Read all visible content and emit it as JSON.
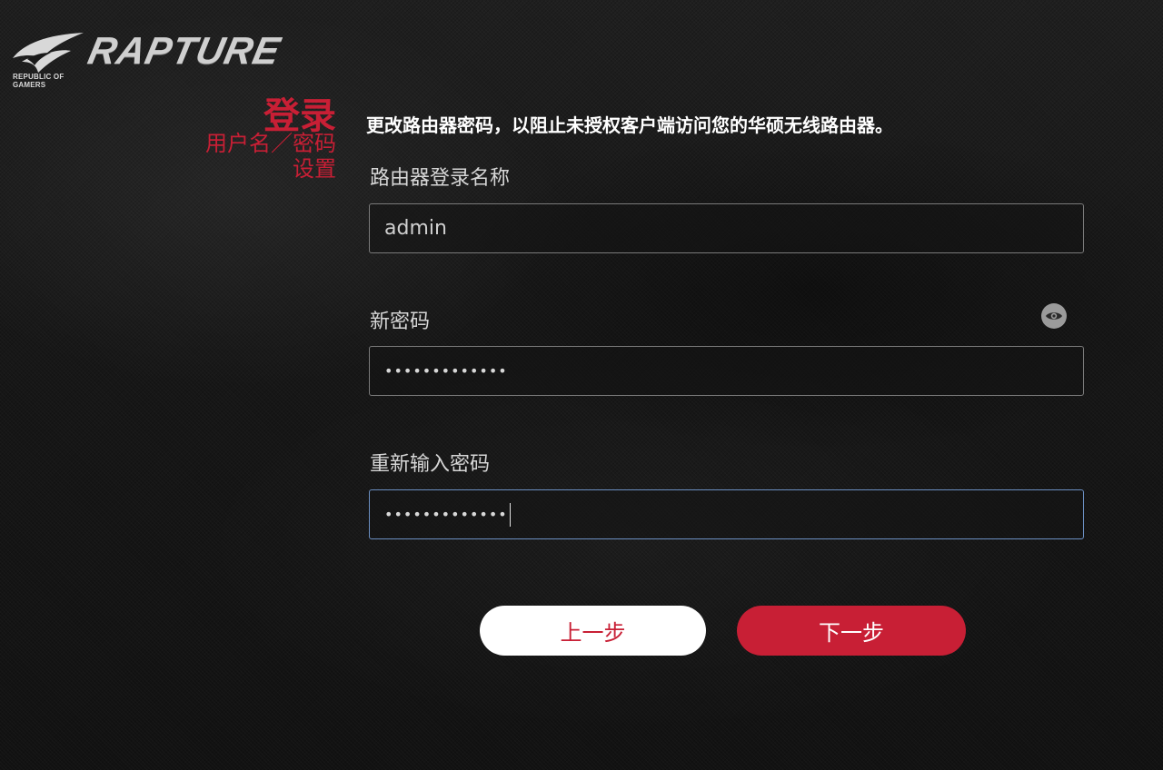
{
  "brand": {
    "wordmark": "RAPTURE",
    "sub_line": "REPUBLIC OF\nGAMERS",
    "accent_color": "#c81f35"
  },
  "side": {
    "title": "登录",
    "subtitle_line1": "用户名／密码",
    "subtitle_line2": "设置"
  },
  "form": {
    "intro": "更改路由器密码，以阻止未授权客户端访问您的华硕无线路由器。",
    "login_name": {
      "label": "路由器登录名称",
      "value": "admin"
    },
    "new_password": {
      "label": "新密码",
      "masked_value": "•••••••••••••",
      "toggle_icon": "eye-icon"
    },
    "confirm_password": {
      "label": "重新输入密码",
      "masked_value": "•••••••••••••"
    }
  },
  "buttons": {
    "prev_label": "上一步",
    "next_label": "下一步"
  }
}
